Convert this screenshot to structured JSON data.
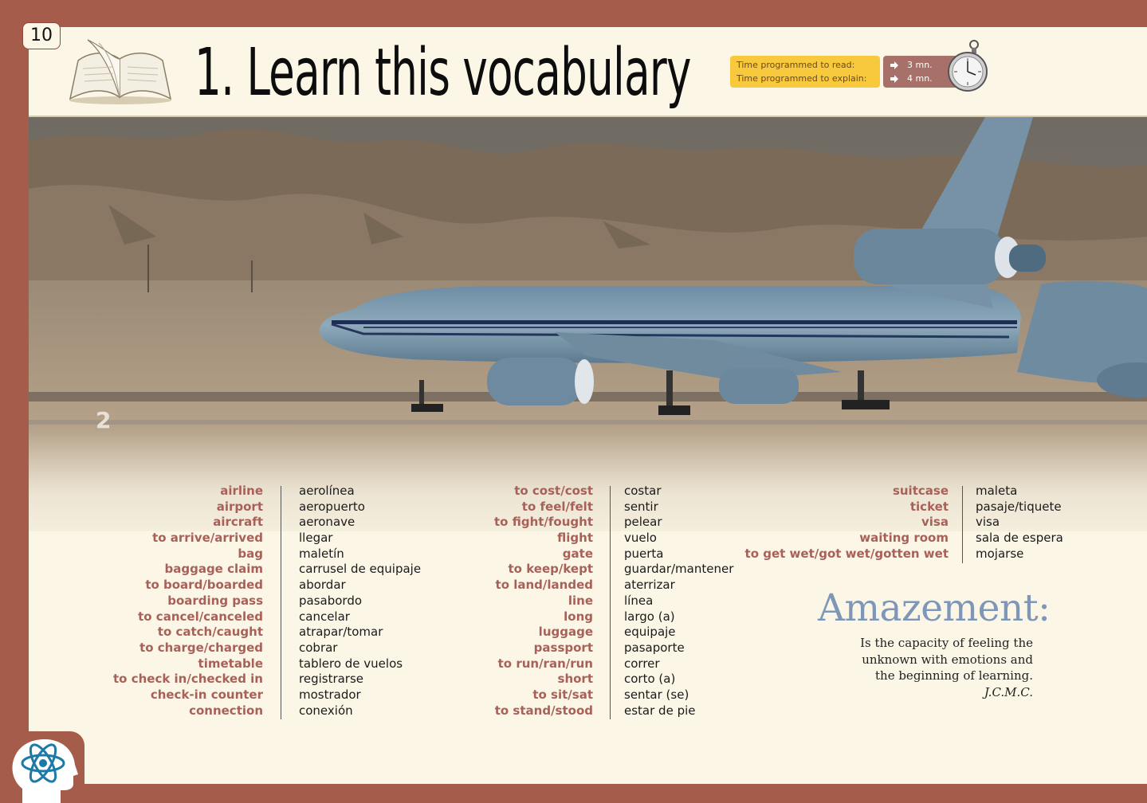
{
  "page_number": "10",
  "title": "1. Learn this vocabulary",
  "time": {
    "read_label": "Time programmed to read:",
    "explain_label": "Time programmed to explain:",
    "read_value": "3 mn.",
    "explain_value": "4 mn."
  },
  "vocab": {
    "col1_en": [
      "airline",
      "airport",
      "aircraft",
      "to arrive/arrived",
      "bag",
      "baggage claim",
      "to board/boarded",
      "boarding pass",
      "to cancel/canceled",
      "to catch/caught",
      "to charge/charged",
      "timetable",
      "to check in/checked in",
      "check-in counter",
      "connection"
    ],
    "col1_es": [
      "aerolínea",
      "aeropuerto",
      "aeronave",
      "llegar",
      "maletín",
      "carrusel de equipaje",
      "abordar",
      "pasabordo",
      "cancelar",
      "atrapar/tomar",
      "cobrar",
      "tablero de vuelos",
      "registrarse",
      "mostrador",
      "conexión"
    ],
    "col2_en": [
      "to cost/cost",
      "to feel/felt",
      "to fight/fought",
      "flight",
      "gate",
      "to keep/kept",
      "to land/landed",
      "line",
      "long",
      "luggage",
      "passport",
      "to run/ran/run",
      "short",
      "to sit/sat",
      "to stand/stood"
    ],
    "col2_es": [
      "costar",
      "sentir",
      "pelear",
      "vuelo",
      "puerta",
      "guardar/mantener",
      "aterrizar",
      "línea",
      "largo (a)",
      "equipaje",
      "pasaporte",
      "correr",
      "corto (a)",
      "sentar (se)",
      "estar de pie"
    ],
    "col3_en": [
      "suitcase",
      "ticket",
      "visa",
      "waiting room",
      "to get wet/got wet/gotten wet"
    ],
    "col3_es": [
      "maleta",
      "pasaje/tiquete",
      "visa",
      "sala de espera",
      "mojarse"
    ]
  },
  "amazement": {
    "title": "Amazement:",
    "lines": [
      "Is the capacity of feeling the",
      "unknown with emotions and",
      "the beginning of learning."
    ],
    "author": "J.C.M.C."
  },
  "icons": [
    "open-book-icon",
    "stopwatch-icon",
    "arrow-right-icon",
    "brain-atom-icon"
  ],
  "colors": {
    "border": "#a65c4b",
    "page": "#fbf6e6",
    "english_word": "#a86158",
    "amazement_title": "#7e97b8",
    "time_box": "#f8c93d"
  }
}
